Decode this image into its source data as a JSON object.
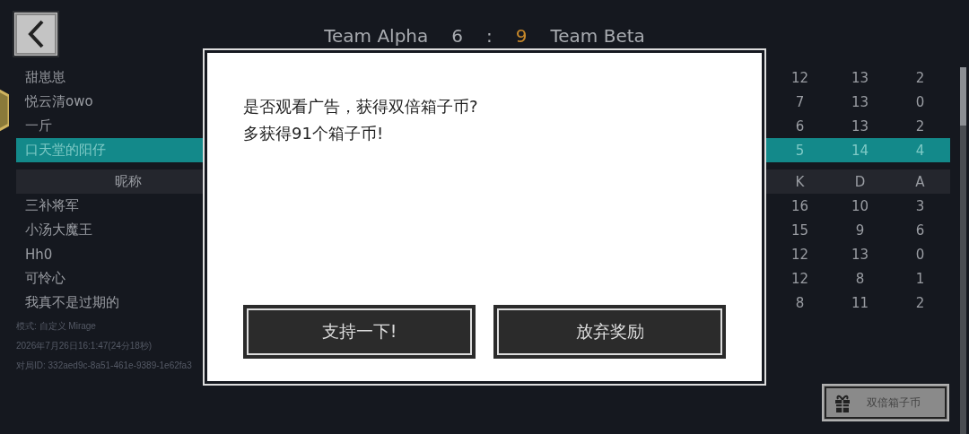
{
  "header": {
    "team_a": "Team Alpha",
    "score_a": "6",
    "separator": ":",
    "score_b": "9",
    "team_b": "Team Beta"
  },
  "team_a_rows": [
    {
      "name": "甜崽崽",
      "k": "12",
      "d": "13",
      "a": "2",
      "selected": false
    },
    {
      "name": "悦云清owo",
      "k": "7",
      "d": "13",
      "a": "0",
      "selected": false
    },
    {
      "name": "一斤",
      "k": "6",
      "d": "13",
      "a": "2",
      "selected": false
    },
    {
      "name": "口天堂的阳仔",
      "k": "5",
      "d": "14",
      "a": "4",
      "selected": true
    }
  ],
  "columns": [
    "昵称",
    "K",
    "D",
    "A"
  ],
  "team_b_rows": [
    {
      "name": "三补将军",
      "k": "16",
      "d": "10",
      "a": "3",
      "selected": false
    },
    {
      "name": "小汤大魔王",
      "k": "15",
      "d": "9",
      "a": "6",
      "selected": false
    },
    {
      "name": "Hh0",
      "k": "12",
      "d": "13",
      "a": "0",
      "selected": false
    },
    {
      "name": "可怜心",
      "k": "12",
      "d": "8",
      "a": "1",
      "selected": false
    },
    {
      "name": "我真不是过期的",
      "k": "8",
      "d": "11",
      "a": "2",
      "selected": false
    }
  ],
  "match_info": [
    "模式: 自定义 Mirage",
    "2026年7月26日16:1:47(24分18秒)",
    "对局ID: 332aed9c-8a51-461e-9389-1e62fa3"
  ],
  "dialog": {
    "message": [
      "是否观看广告，获得双倍箱子币?",
      "多获得91个箱子币!"
    ],
    "buttons": [
      "支持一下!",
      "放弃奖励"
    ]
  },
  "double_coins_button": "双倍箱子币"
}
